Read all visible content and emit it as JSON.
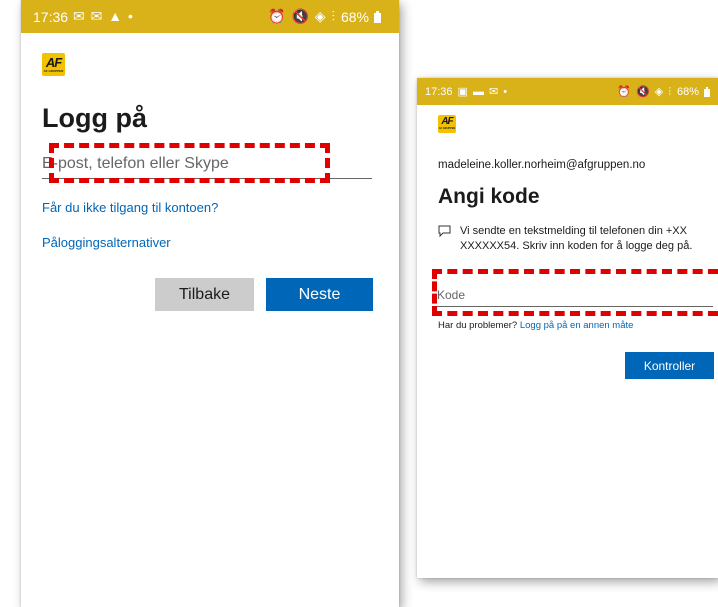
{
  "left_screen": {
    "status_bar": {
      "time": "17:36",
      "left_icons": "✉ ✉ ▲ •",
      "right_icons": "⏰ 🔇 ◈ ⫶",
      "battery": "68%"
    },
    "logo": {
      "mark": "AF",
      "sub": "AF GRUPPEN"
    },
    "title": "Logg på",
    "login_field_placeholder": "E-post, telefon eller Skype",
    "cant_access_link": "Får du ikke tilgang til kontoen?",
    "signin_options_link": "Påloggingsalternativer",
    "back_button": "Tilbake",
    "next_button": "Neste"
  },
  "right_screen": {
    "status_bar": {
      "time": "17:36",
      "left_icons": "▣ ▬ ✉ •",
      "right_icons": "⏰ 🔇 ◈ ⫶",
      "battery": "68%"
    },
    "logo": {
      "mark": "AF",
      "sub": "AF GRUPPEN"
    },
    "user_email": "madeleine.koller.norheim@afgruppen.no",
    "title": "Angi kode",
    "sms_message": "Vi sendte en tekstmelding til telefonen din +XX XXXXXX54. Skriv inn koden for å logge deg på.",
    "code_field_placeholder": "Kode",
    "help_prefix": "Har du problemer?",
    "help_link": "Logg på på en annen måte",
    "verify_button": "Kontroller"
  },
  "icons": {
    "chat": "chat-bubble-icon",
    "battery": "battery-icon"
  },
  "colors": {
    "status_bar": "#d9b21a",
    "logo": "#f2c200",
    "link": "#0067b8",
    "primary_button": "#0067b8",
    "secondary_button": "#cccccc",
    "highlight": "#e00000"
  }
}
